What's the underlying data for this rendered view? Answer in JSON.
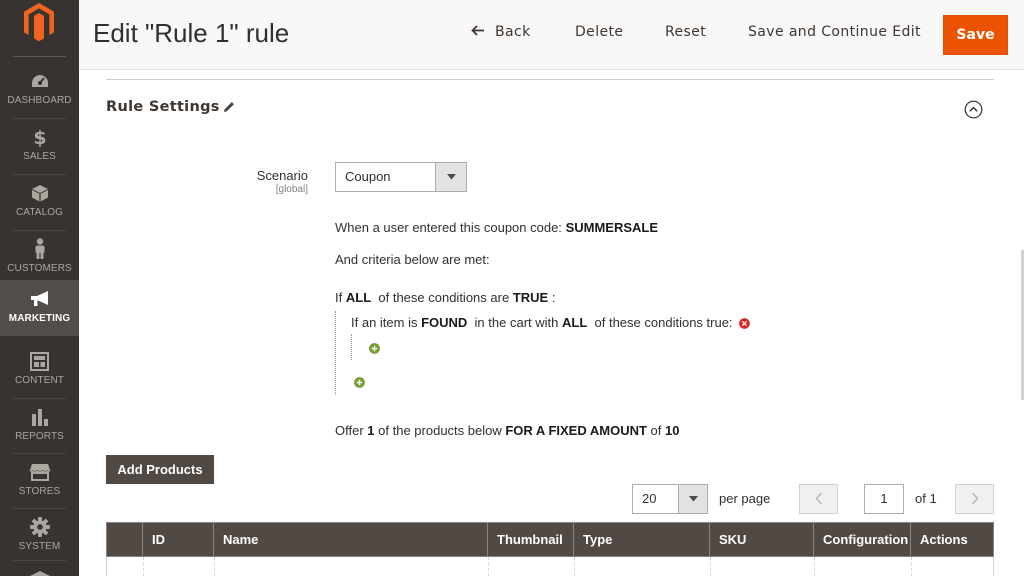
{
  "colors": {
    "sidebar": "#373330",
    "sidebar_active": "#524d49",
    "accent": "#eb5202",
    "dark_button": "#514943",
    "grid_header": "#514943"
  },
  "sidebar": {
    "logo_icon": "magento-logo-icon",
    "items": [
      {
        "label": "DASHBOARD",
        "icon": "speedometer-icon",
        "active": false
      },
      {
        "label": "SALES",
        "icon": "dollar-icon",
        "active": false
      },
      {
        "label": "CATALOG",
        "icon": "cube-icon",
        "active": false
      },
      {
        "label": "CUSTOMERS",
        "icon": "person-icon",
        "active": false
      },
      {
        "label": "MARKETING",
        "icon": "megaphone-icon",
        "active": true
      },
      {
        "label": "CONTENT",
        "icon": "layout-icon",
        "active": false
      },
      {
        "label": "REPORTS",
        "icon": "bar-chart-icon",
        "active": false
      },
      {
        "label": "STORES",
        "icon": "store-icon",
        "active": false
      },
      {
        "label": "SYSTEM",
        "icon": "gear-icon",
        "active": false
      }
    ]
  },
  "header": {
    "title": "Edit \"Rule 1\" rule",
    "back_label": "Back",
    "delete_label": "Delete",
    "reset_label": "Reset",
    "save_continue_label": "Save and Continue Edit",
    "save_label": "Save"
  },
  "section": {
    "title": "Rule Settings"
  },
  "form": {
    "scenario_label": "Scenario",
    "scenario_scope": "[global]",
    "scenario_value": "Coupon"
  },
  "conditions": {
    "coupon_prefix": "When a user entered this coupon code:",
    "coupon_code": "SUMMERSALE",
    "criteria_text": "And criteria below are met:",
    "if_text": "If",
    "aggregator": "ALL",
    "mid_text": "of these conditions are",
    "value": "TRUE",
    "colon": ":",
    "nested": {
      "prefix": "If an item is",
      "found": "FOUND",
      "mid": "in the cart with",
      "aggregator": "ALL",
      "suffix": "of these conditions true:"
    }
  },
  "offer": {
    "prefix": "Offer",
    "qty": "1",
    "mid": "of the products below",
    "type": "FOR A FIXED AMOUNT",
    "of_text": "of",
    "amount": "10"
  },
  "grid": {
    "add_button": "Add Products",
    "per_page_value": "20",
    "per_page_label": "per page",
    "current_page": "1",
    "total_pages_text": "of 1",
    "columns": [
      "",
      "ID",
      "Name",
      "Thumbnail",
      "Type",
      "SKU",
      "Configuration",
      "Actions"
    ]
  }
}
